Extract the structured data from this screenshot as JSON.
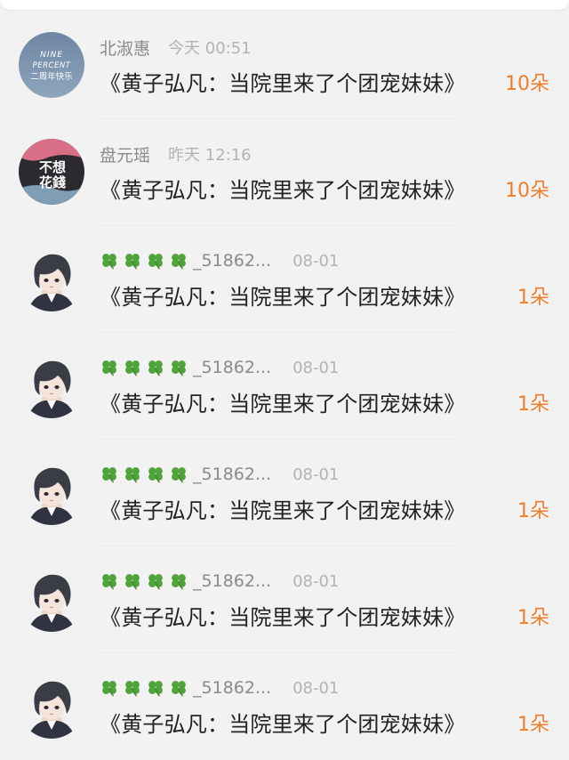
{
  "colors": {
    "background": "#f2f2f2",
    "username_gray": "#8a8a8a",
    "time_gray": "#b3b3b3",
    "count_orange": "#ef7e2c",
    "message_text": "#222222"
  },
  "gift_list": [
    {
      "avatar": "nine-percent-logo-avatar",
      "avatar_text": [
        "NINE",
        "PERCENT",
        "二周年快乐"
      ],
      "username": "北淑惠",
      "clovers": 0,
      "time": "今天 00:51",
      "message": "《黄子弘凡：当院里来了个团宠妹妹》",
      "count": "10朵"
    },
    {
      "avatar": "calligraphy-avatar",
      "avatar_text": [
        "不想",
        "花錢"
      ],
      "username": "盘元瑶",
      "clovers": 0,
      "time": "昨天 12:16",
      "message": "《黄子弘凡：当院里来了个团宠妹妹》",
      "count": "10朵"
    },
    {
      "avatar": "anime-boy-avatar",
      "username": "_51862...",
      "clovers": 4,
      "clover_icon": "four-leaf-clover-icon",
      "time": "08-01",
      "message": "《黄子弘凡：当院里来了个团宠妹妹》",
      "count": "1朵"
    },
    {
      "avatar": "anime-boy-avatar",
      "username": "_51862...",
      "clovers": 4,
      "clover_icon": "four-leaf-clover-icon",
      "time": "08-01",
      "message": "《黄子弘凡：当院里来了个团宠妹妹》",
      "count": "1朵"
    },
    {
      "avatar": "anime-boy-avatar",
      "username": "_51862...",
      "clovers": 4,
      "clover_icon": "four-leaf-clover-icon",
      "time": "08-01",
      "message": "《黄子弘凡：当院里来了个团宠妹妹》",
      "count": "1朵"
    },
    {
      "avatar": "anime-boy-avatar",
      "username": "_51862...",
      "clovers": 4,
      "clover_icon": "four-leaf-clover-icon",
      "time": "08-01",
      "message": "《黄子弘凡：当院里来了个团宠妹妹》",
      "count": "1朵"
    },
    {
      "avatar": "anime-boy-avatar",
      "username": "_51862...",
      "clovers": 4,
      "clover_icon": "four-leaf-clover-icon",
      "time": "08-01",
      "message": "《黄子弘凡：当院里来了个团宠妹妹》",
      "count": "1朵"
    }
  ]
}
